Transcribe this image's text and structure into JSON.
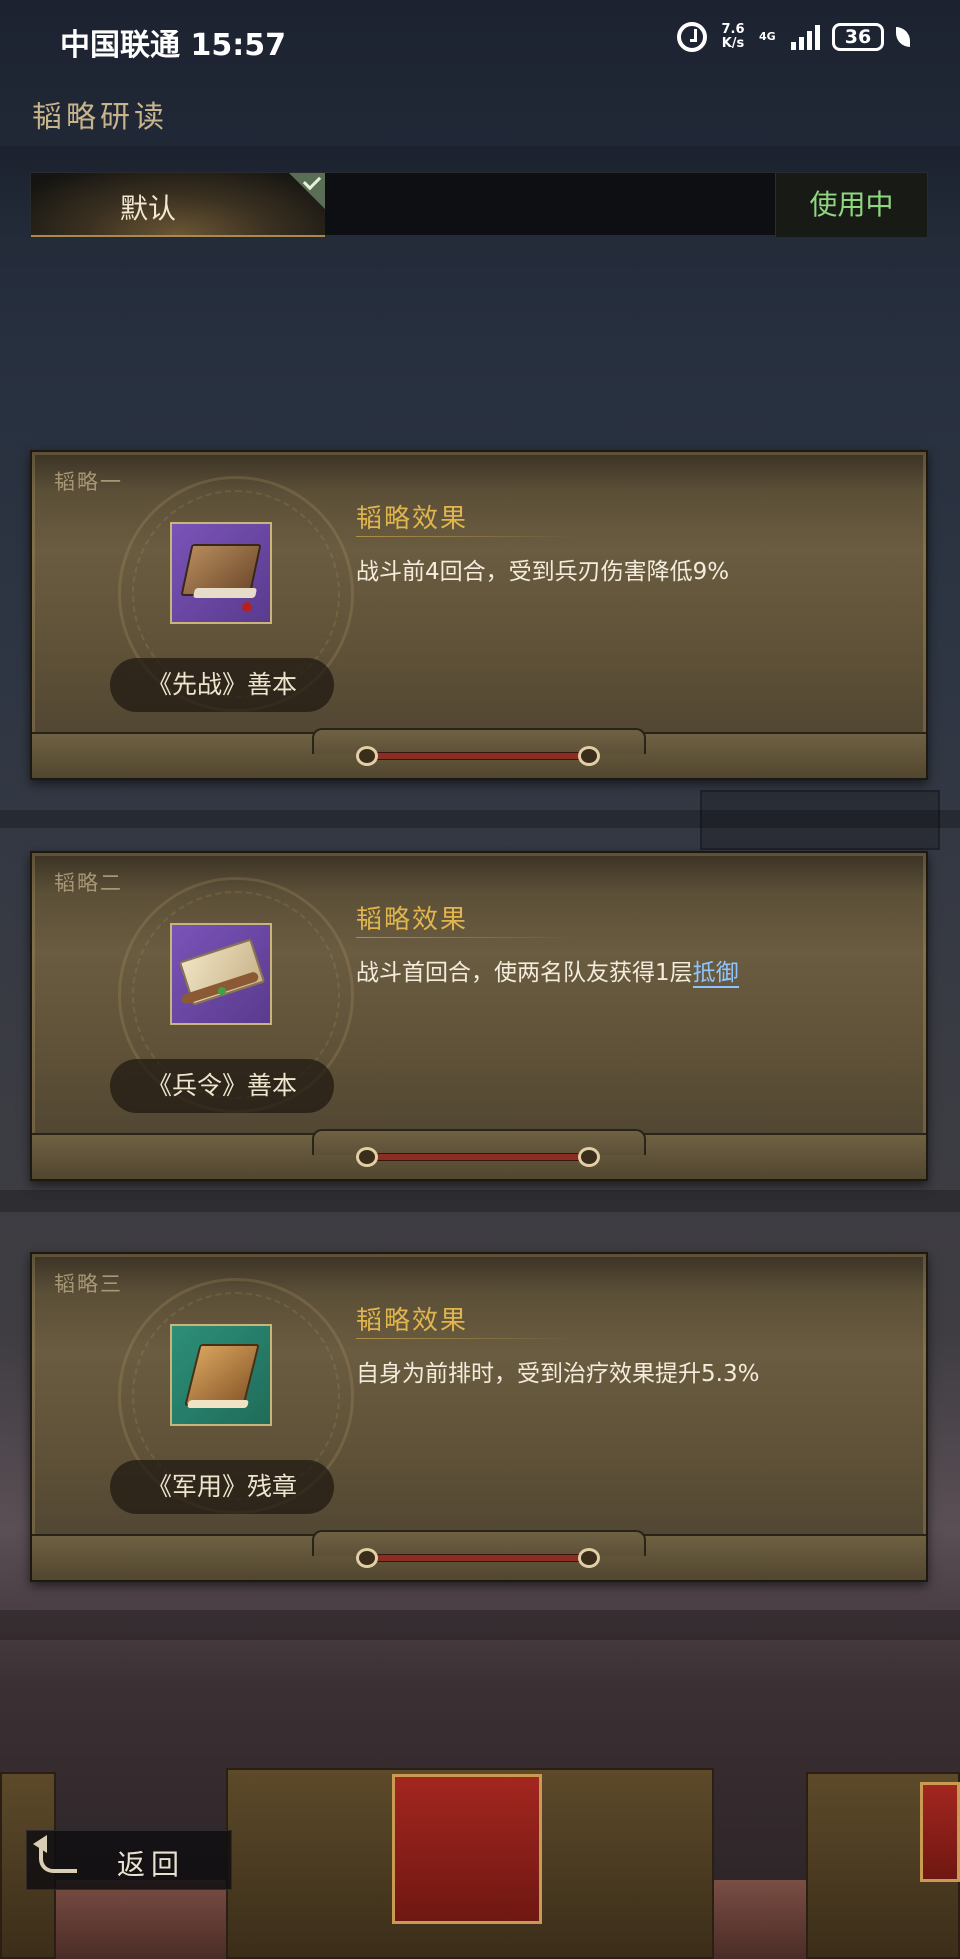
{
  "status_bar": {
    "carrier_time": "中国联通 15:57",
    "net_speed": "7.6 K/s",
    "network": "4G",
    "battery": "36"
  },
  "header": {
    "title": "韬略研读"
  },
  "preset": {
    "tab_label": "默认",
    "use_button": "使用中"
  },
  "cards": [
    {
      "slot": "韬略一",
      "item_name": "《先战》善本",
      "effect_title": "韬略效果",
      "effect_text": "战斗前4回合，受到兵刃伤害降低9%",
      "frame_color": "#6b4aa3"
    },
    {
      "slot": "韬略二",
      "item_name": "《兵令》善本",
      "effect_title": "韬略效果",
      "effect_text": "战斗首回合，使两名队友获得1层",
      "effect_link": "抵御",
      "frame_color": "#6b4aa3"
    },
    {
      "slot": "韬略三",
      "item_name": "《军用》残章",
      "effect_title": "韬略效果",
      "effect_text": "自身为前排时，受到治疗效果提升5.3%",
      "frame_color": "#2a7f6b"
    }
  ],
  "footer": {
    "back_label": "返回"
  },
  "colors": {
    "accent_gold": "#e0b54e",
    "active_green": "#8fd77f",
    "link_blue": "#8ec4ff"
  }
}
